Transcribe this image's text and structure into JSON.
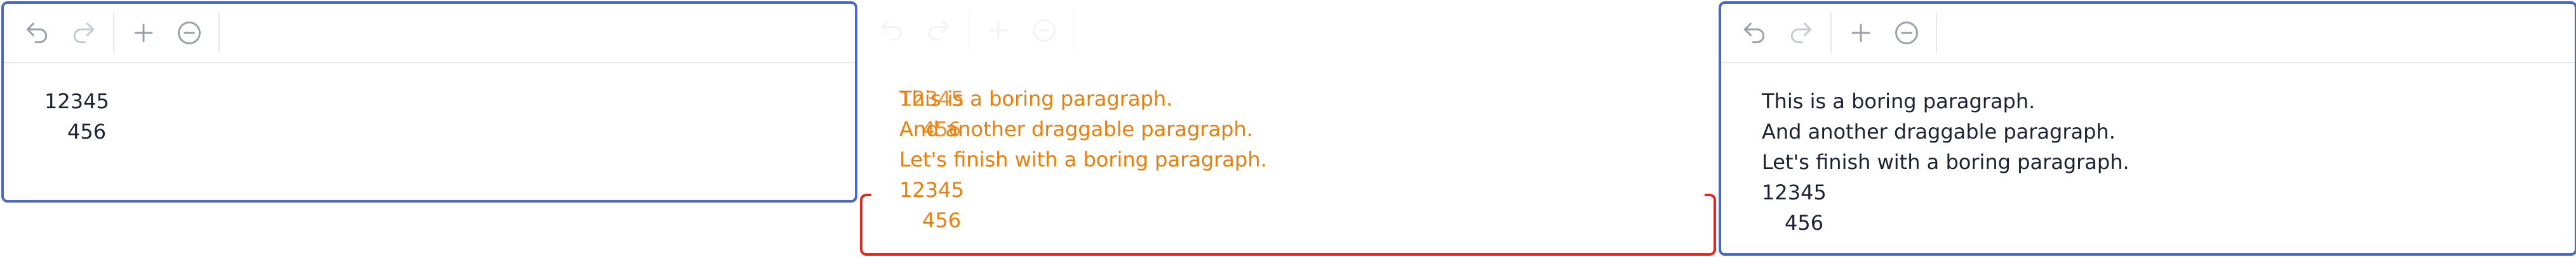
{
  "toolbar": {
    "undo_icon": "undo-icon",
    "redo_icon": "redo-icon",
    "add_icon": "plus-icon",
    "remove_icon": "minus-circle-icon"
  },
  "colors": {
    "editor_border": "#4a68c8",
    "drop_frame": "#e8261c",
    "dragged_text": "#ef7d08",
    "text": "#1a2233",
    "toolbar_icon": "#9aa0ab"
  },
  "editors": {
    "left": {
      "lines": [
        "12345",
        "456"
      ]
    },
    "ghost": {
      "lines": [
        "This is a boring paragraph.",
        "And another draggable paragraph.",
        "Let's finish with a boring paragraph.",
        "12345",
        "456"
      ],
      "overlap_lines": [
        "12345",
        "456"
      ]
    },
    "right": {
      "lines": [
        "This is a boring paragraph.",
        "And another draggable paragraph.",
        "Let's finish with a boring paragraph.",
        "12345",
        "456"
      ]
    }
  }
}
